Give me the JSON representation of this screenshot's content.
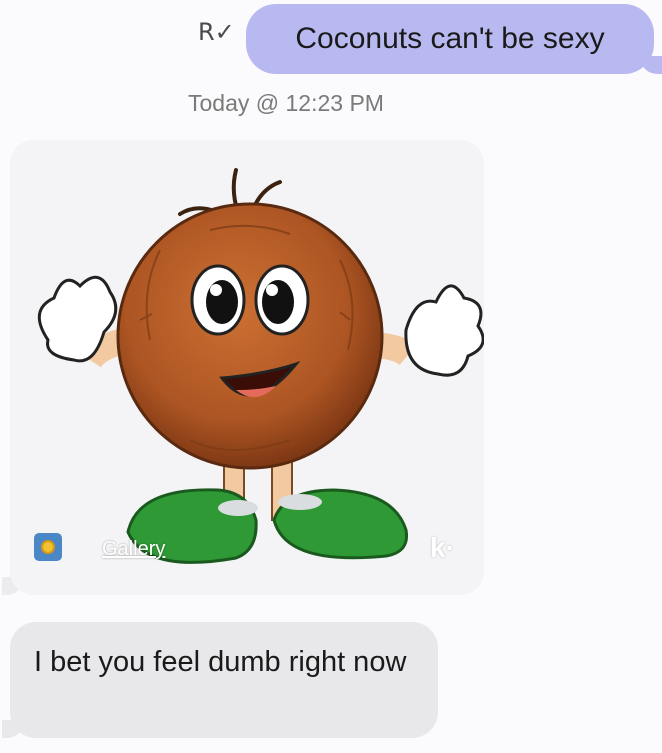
{
  "sent_message": {
    "text": "Coconuts can't be sexy",
    "read_receipt": "R✓"
  },
  "timestamp": "Today @ 12:23 PM",
  "image_attachment": {
    "source_label": "Gallery",
    "provider_mark": "k·",
    "subject_icon": "cartoon-coconut-image",
    "source_icon": "gallery-sunflower-icon"
  },
  "received_message": {
    "text": "I bet you feel dumb right now"
  },
  "colors": {
    "sent_bubble": "#b9b9f1",
    "received_bubble": "#e8e8ea",
    "coconut": "#b35a24",
    "shoes": "#2f9a35"
  }
}
